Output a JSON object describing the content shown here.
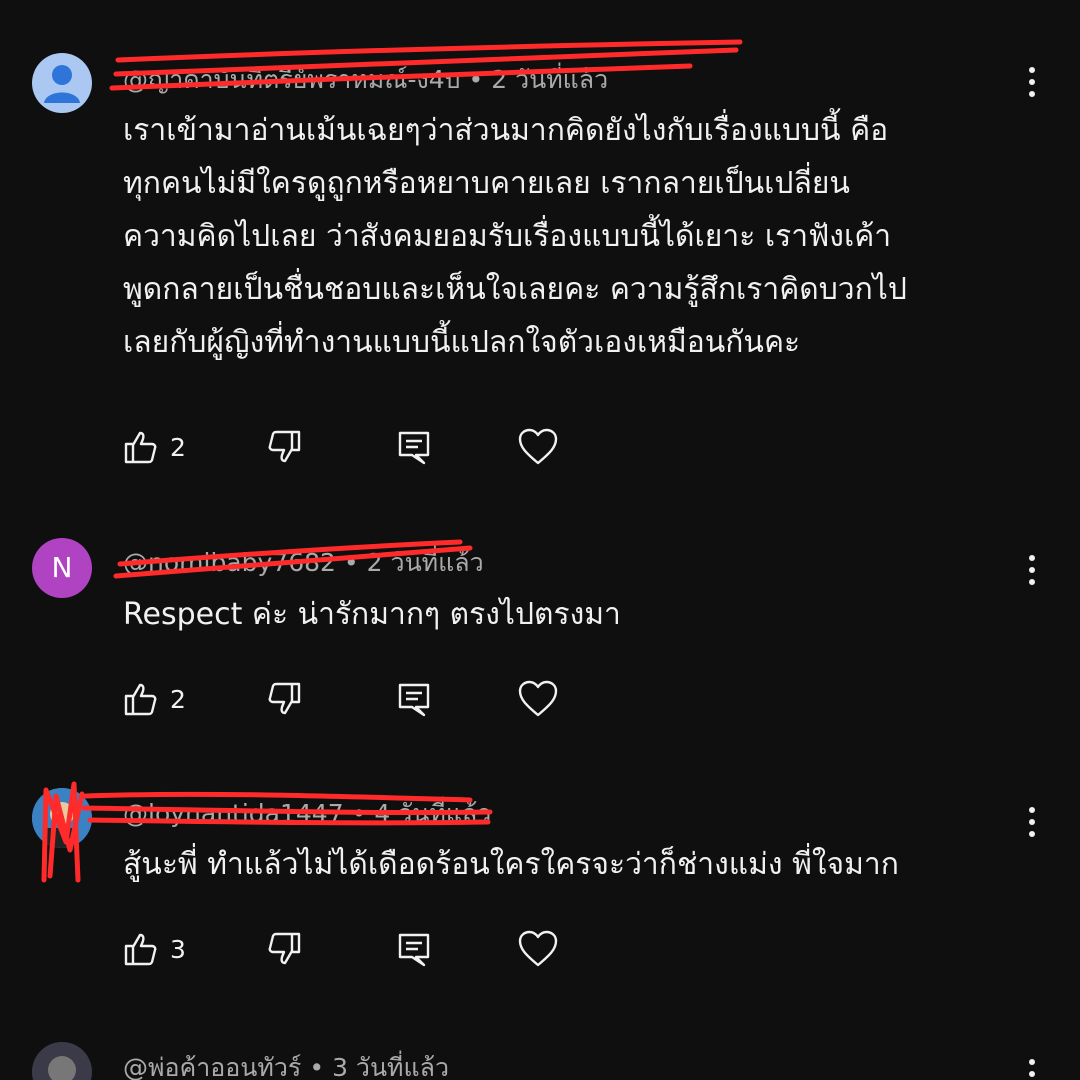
{
  "colors": {
    "background": "#0f0f0f",
    "text": "#f1f1f1",
    "meta": "#aaaaaa",
    "redact_scribble": "#ff2a2a"
  },
  "comments": [
    {
      "author": "@ญาดาบันทิตรีย์พราหมณ์-ง4บ",
      "time": "2 วันที่แล้ว",
      "avatar_icon": "default-user-avatar-icon",
      "text_lines": [
        "เราเข้ามาอ่านเม้นเฉยๆว่าส่วนมากคิดยังไงกับเรื่องแบบนี้ คือ",
        "ทุกคนไม่มีใครดูถูกหรือหยาบคายเลย เรากลายเป็นเปลี่ยน",
        "ความคิดไปเลย ว่าสังคมยอมรับเรื่องแบบนี้ได้เยาะ เราฟังเค้า",
        "พูดกลายเป็นชื่นชอบและเห็นใจเลยคะ ความรู้สึกเราคิดบวกไป",
        "เลยกับผู้ญิงที่ทำงานแบบนี้แปลกใจตัวเองเหมือนกันคะ"
      ],
      "likes": "2"
    },
    {
      "author": "@nomibaby7682",
      "time": "2 วันที่แล้ว",
      "avatar_letter": "N",
      "text_lines": [
        "Respect ค่ะ น่ารักมากๆ ตรงไปตรงมา"
      ],
      "likes": "2"
    },
    {
      "author": "@loynantida1447",
      "time": "4 วันที่แล้ว",
      "avatar_icon": "profile-photo-avatar",
      "text_lines": [
        "สู้นะพี่ ทำแล้วไม่ได้เดือดร้อนใครใครจะว่าก็ช่างแม่ง พี่ใจมาก"
      ],
      "likes": "3"
    },
    {
      "author": "@พ่อค้าออนทัวร์",
      "time": "3 วันที่แล้ว",
      "avatar_icon": "profile-photo-avatar",
      "text_lines": [],
      "likes": ""
    }
  ],
  "ui": {
    "dot_separator": "•",
    "actions": {
      "like_icon": "thumbs-up-icon",
      "dislike_icon": "thumbs-down-icon",
      "reply_icon": "reply-comment-icon",
      "heart_icon": "heart-icon",
      "more_icon": "more-vertical-icon"
    }
  }
}
